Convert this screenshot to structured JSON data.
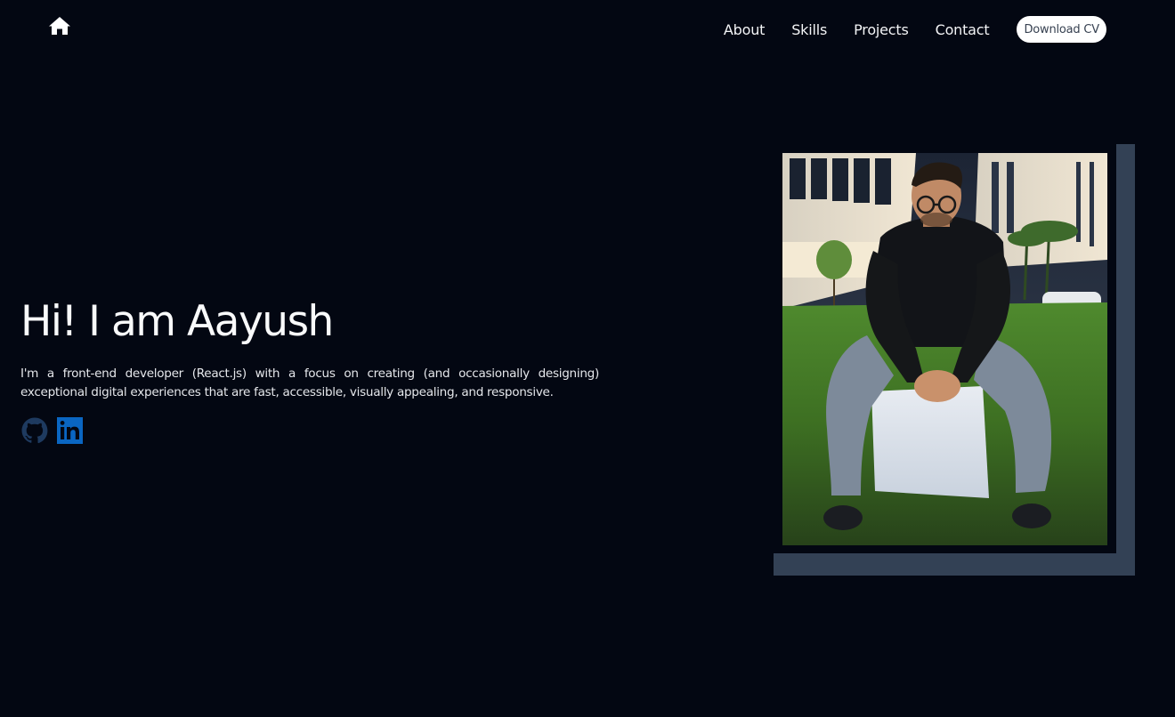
{
  "nav": {
    "home_icon": "home-icon",
    "links": [
      {
        "label": "About"
      },
      {
        "label": "Skills"
      },
      {
        "label": "Projects"
      },
      {
        "label": "Contact"
      }
    ],
    "cv_button": "Download CV"
  },
  "hero": {
    "title": "Hi! I am Aayush",
    "description": "I'm a front-end developer (React.js) with a focus on creating (and occasionally designing) exceptional digital experiences that are fast, accessible, visually appealing, and responsive.",
    "socials": [
      {
        "icon": "github-icon"
      },
      {
        "icon": "linkedin-icon"
      }
    ]
  },
  "portrait": {
    "icon": "profile-photo"
  },
  "colors": {
    "background": "#030712",
    "frame_shadow": "#334155",
    "linkedin_blue": "#0a66c2",
    "github_blue": "#1e3a5f"
  }
}
